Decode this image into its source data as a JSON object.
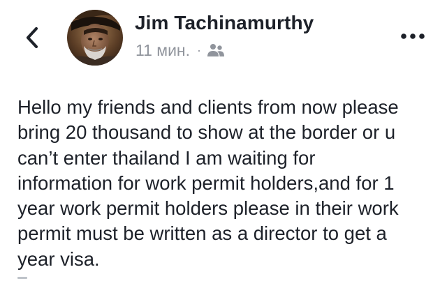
{
  "post": {
    "author": {
      "name": "Jim Tachinamurthy",
      "avatar_icon": "user-avatar-photo"
    },
    "meta": {
      "time": "11 мин.",
      "separator": "·",
      "audience_icon": "friends-icon"
    },
    "body": "Hello my friends and clients from now please\nbring 20 thousand to show at the border or u\ncan’t enter thailand I am waiting for\ninformation for work permit holders,and for 1\nyear work permit holders please in their work\npermit must be written as a director to get a\nyear visa."
  },
  "nav": {
    "back_icon": "chevron-left-icon",
    "more_icon": "more-horizontal-icon"
  },
  "colors": {
    "text": "#1d2129",
    "meta": "#90949c",
    "background": "#ffffff"
  }
}
